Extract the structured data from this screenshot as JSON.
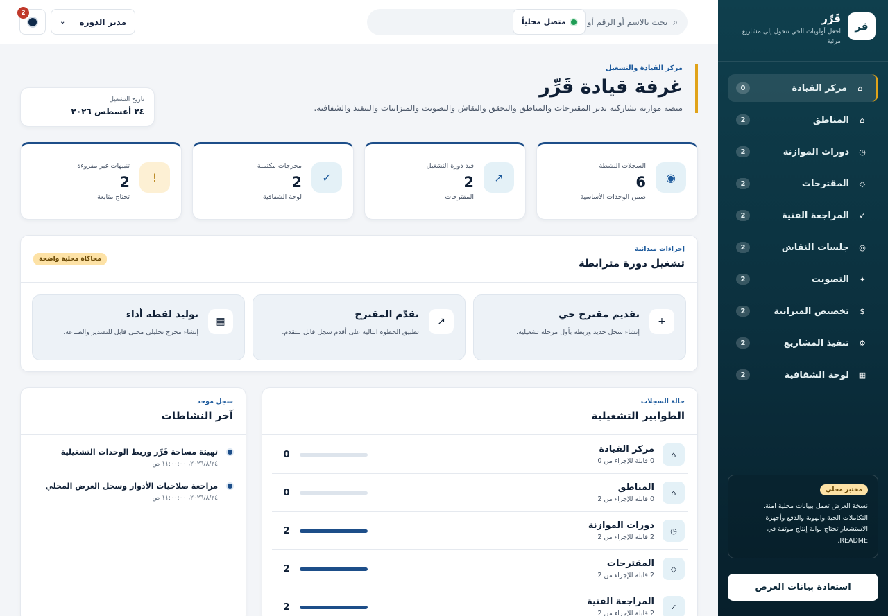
{
  "sidebar": {
    "logo": "قر",
    "brand_name": "قَرِّر",
    "brand_sub": "اجعل أولويات الحي تتحول إلى مشاريع مرئية",
    "items": [
      {
        "label": "مركز القيادة",
        "count": "0",
        "icon": "home-icon"
      },
      {
        "label": "المناطق",
        "count": "2",
        "icon": "map-icon"
      },
      {
        "label": "دورات الموازنة",
        "count": "2",
        "icon": "clock-icon"
      },
      {
        "label": "المقترحات",
        "count": "2",
        "icon": "diamond-icon"
      },
      {
        "label": "المراجعة الفنية",
        "count": "2",
        "icon": "check-icon"
      },
      {
        "label": "جلسات النقاش",
        "count": "2",
        "icon": "target-icon"
      },
      {
        "label": "التصويت",
        "count": "2",
        "icon": "sparkle-icon"
      },
      {
        "label": "تخصيص الميزانية",
        "count": "2",
        "icon": "dollar-icon"
      },
      {
        "label": "تنفيذ المشاريع",
        "count": "2",
        "icon": "gear-icon"
      },
      {
        "label": "لوحة الشفافية",
        "count": "2",
        "icon": "grid-icon"
      }
    ],
    "lab_badge": "مختبر محلي",
    "lab_text": "نسخة العرض تعمل ببيانات محلية آمنة. التكاملات الحية والهوية والدفع وأجهزة الاستشعار تحتاج بوابة إنتاج موثقة في README.",
    "restore_label": "استعادة بيانات العرض"
  },
  "topbar": {
    "search_placeholder": "بحث بالاسم أو الرقم أو الحالة...",
    "status_label": "متصل محلياً",
    "role_value": "مدير الدورة",
    "notifications_count": "2"
  },
  "hero": {
    "eyebrow": "مركز القيادة والتشغيل",
    "title": "غرفة قيادة قَرِّر",
    "description": "منصة موازنة تشاركية تدير المقترحات والمناطق والتحقق والنقاش والتصويت والميزانيات والتنفيذ والشفافية.",
    "date_label": "تاريخ التشغيل",
    "date_value": "٢٤ أغسطس ٢٠٢٦"
  },
  "kpis": [
    {
      "label": "السجلات النشطة",
      "value": "6",
      "sub": "ضمن الوحدات الأساسية",
      "icon": "record-icon"
    },
    {
      "label": "قيد دورة التشغيل",
      "value": "2",
      "sub": "المقترحات",
      "icon": "arrow-up-icon"
    },
    {
      "label": "مخرجات مكتملة",
      "value": "2",
      "sub": "لوحة الشفافية",
      "icon": "check-icon"
    },
    {
      "label": "تنبيهات غير مقروءة",
      "value": "2",
      "sub": "تحتاج متابعة",
      "icon": "alert-icon"
    }
  ],
  "actions": {
    "eyebrow": "إجراءات ميدانية",
    "title": "تشغيل دورة مترابطة",
    "badge": "محاكاة محلية واضحة",
    "cards": [
      {
        "title": "تقديم مقترح حي",
        "desc": "إنشاء سجل جديد وربطه بأول مرحلة تشغيلية.",
        "icon": "plus-icon"
      },
      {
        "title": "تقدّم المقترح",
        "desc": "تطبيق الخطوة التالية على أقدم سجل قابل للتقدم.",
        "icon": "arrow-up-icon"
      },
      {
        "title": "توليد لقطة أداء",
        "desc": "إنشاء مخرج تحليلي محلي قابل للتصدير والطباعة.",
        "icon": "grid-icon"
      }
    ]
  },
  "queues": {
    "eyebrow": "حالة السجلات",
    "title": "الطوابير التشغيلية",
    "rows": [
      {
        "title": "مركز القيادة",
        "sub": "0 قابلة للإجراء من 0",
        "value": "0",
        "fill": 0,
        "icon": "home-icon"
      },
      {
        "title": "المناطق",
        "sub": "0 قابلة للإجراء من 2",
        "value": "0",
        "fill": 0,
        "icon": "map-icon"
      },
      {
        "title": "دورات الموازنة",
        "sub": "2 قابلة للإجراء من 2",
        "value": "2",
        "fill": 1,
        "icon": "clock-icon"
      },
      {
        "title": "المقترحات",
        "sub": "2 قابلة للإجراء من 2",
        "value": "2",
        "fill": 1,
        "icon": "diamond-icon"
      },
      {
        "title": "المراجعة الفنية",
        "sub": "2 قابلة للإجراء من 2",
        "value": "2",
        "fill": 1,
        "icon": "check-icon"
      }
    ]
  },
  "activity": {
    "eyebrow": "سجل موحد",
    "title": "آخر النشاطات",
    "items": [
      {
        "title": "تهيئة مساحة قَرِّر وربط الوحدات التشغيلية",
        "time": "٢٠٢٦/٨/٢٤، ١١:٠٠:٠٠ ص"
      },
      {
        "title": "مراجعة صلاحيات الأدوار وسجل العرض المحلي",
        "time": "٢٠٢٦/٨/٢٤، ١١:٠٠:٠٠ ص"
      }
    ]
  },
  "colors": {
    "accent": "#e0a31a",
    "primary": "#1d4e89",
    "sidebar": "#0f3f4d",
    "success": "#1f9d55",
    "danger": "#c0392b"
  }
}
